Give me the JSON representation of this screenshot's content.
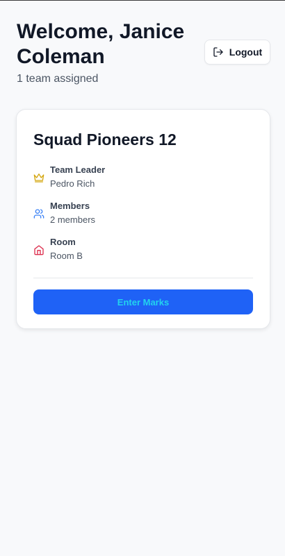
{
  "header": {
    "welcome": "Welcome, Janice Coleman",
    "subtitle": "1 team assigned",
    "logout_label": "Logout"
  },
  "card": {
    "team_name": "Squad Pioneers 12",
    "rows": [
      {
        "icon": "crown-icon",
        "label": "Team Leader",
        "value": "Pedro Rich",
        "color": "#d4a60f"
      },
      {
        "icon": "users-icon",
        "label": "Members",
        "value": "2 members",
        "color": "#3b82f6"
      },
      {
        "icon": "home-icon",
        "label": "Room",
        "value": "Room B",
        "color": "#dc2f4e"
      }
    ],
    "action_label": "Enter Marks"
  },
  "colors": {
    "background": "#f8f9fb",
    "primary": "#1f62f6",
    "primary_text": "#22d3ee"
  }
}
